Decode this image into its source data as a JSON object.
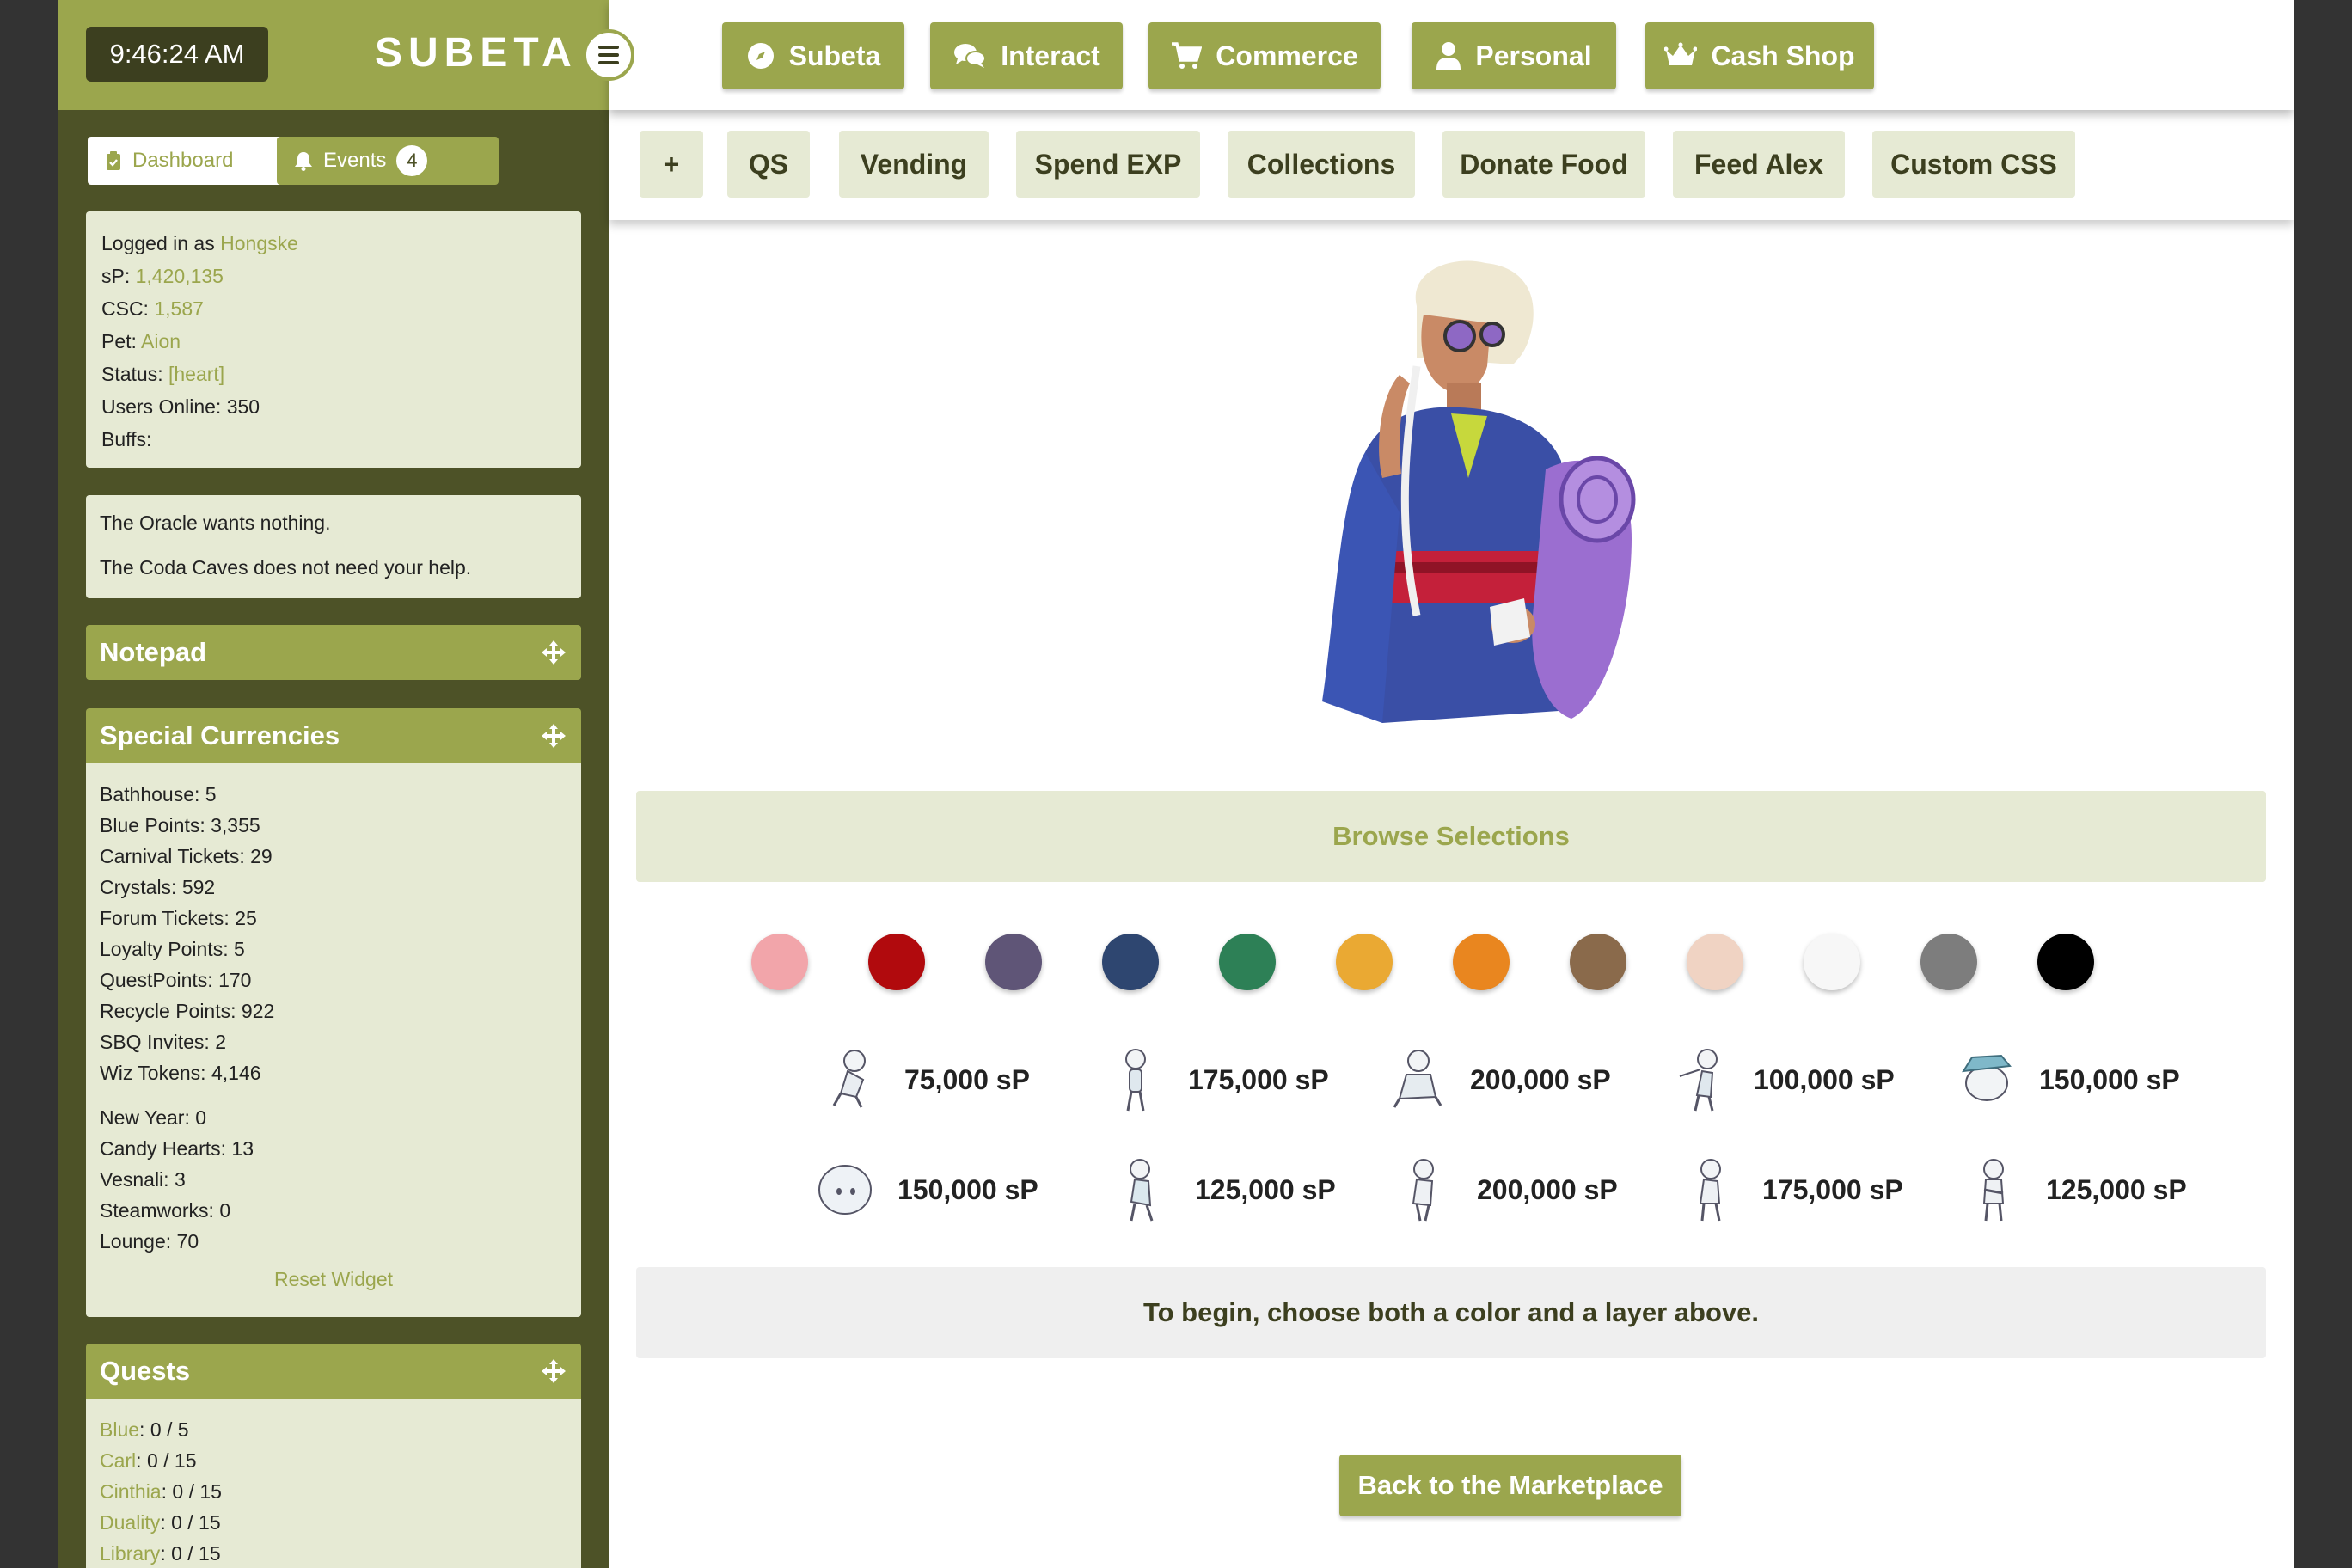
{
  "header": {
    "clock": "9:46:24 AM",
    "site_name": "SUBETA"
  },
  "sidebar": {
    "tabs": {
      "dashboard": "Dashboard",
      "events": "Events",
      "events_count": "4"
    },
    "user": {
      "logged_in_label": "Logged in as ",
      "username": "Hongske",
      "sp_label": "sP: ",
      "sp_value": "1,420,135",
      "csc_label": "CSC: ",
      "csc_value": "1,587",
      "pet_label": "Pet: ",
      "pet_value": "Aion",
      "status_label": "Status: ",
      "status_value": "[heart]",
      "users_online": "Users Online: 350",
      "buffs": "Buffs:"
    },
    "oracle": {
      "line1": "The Oracle wants nothing.",
      "line2": "The Coda Caves does not need your help."
    },
    "notepad": {
      "title": "Notepad"
    },
    "currencies": {
      "title": "Special Currencies",
      "group1": [
        "Bathhouse: 5",
        "Blue Points: 3,355",
        "Carnival Tickets: 29",
        "Crystals: 592",
        "Forum Tickets: 25",
        "Loyalty Points: 5",
        "QuestPoints: 170",
        "Recycle Points: 922",
        "SBQ Invites: 2",
        "Wiz Tokens: 4,146"
      ],
      "group2": [
        "New Year: 0",
        "Candy Hearts: 13",
        "Vesnali: 3",
        "Steamworks: 0",
        "Lounge: 70"
      ],
      "reset": "Reset Widget"
    },
    "quests": {
      "title": "Quests",
      "items": [
        {
          "name": "Blue",
          "progress": ": 0 / 5"
        },
        {
          "name": "Carl",
          "progress": ": 0 / 15"
        },
        {
          "name": "Cinthia",
          "progress": ": 0 / 15"
        },
        {
          "name": "Duality",
          "progress": ": 0 / 15"
        },
        {
          "name": "Library",
          "progress": ": 0 / 15"
        }
      ]
    }
  },
  "top_nav": [
    {
      "label": "Subeta",
      "icon": "compass-icon"
    },
    {
      "label": "Interact",
      "icon": "chat-bubbles-icon"
    },
    {
      "label": "Commerce",
      "icon": "cart-icon"
    },
    {
      "label": "Personal",
      "icon": "user-icon"
    },
    {
      "label": "Cash Shop",
      "icon": "crown-icon"
    }
  ],
  "sub_nav": [
    "+",
    "QS",
    "Vending",
    "Spend EXP",
    "Collections",
    "Donate Food",
    "Feed Alex",
    "Custom CSS"
  ],
  "main": {
    "browse_label": "Browse Selections",
    "colors": [
      "#f2a5aa",
      "#b10a0d",
      "#5f5577",
      "#2e4670",
      "#2d8056",
      "#eaa933",
      "#e9861f",
      "#8a6a4b",
      "#f0d3c3",
      "#f7f7f7",
      "#7d7d7d",
      "#000000"
    ],
    "layers_row1": [
      {
        "price": "75,000 sP",
        "icon": "pose-sitting-icon"
      },
      {
        "price": "175,000 sP",
        "icon": "pose-standing-icon"
      },
      {
        "price": "200,000 sP",
        "icon": "pose-crouching-icon"
      },
      {
        "price": "100,000 sP",
        "icon": "pose-pointing-icon"
      },
      {
        "price": "150,000 sP",
        "icon": "hat-head-icon"
      }
    ],
    "layers_row2": [
      {
        "price": "150,000 sP",
        "icon": "head-icon"
      },
      {
        "price": "125,000 sP",
        "icon": "pose-bent-icon"
      },
      {
        "price": "200,000 sP",
        "icon": "pose-leaning-icon"
      },
      {
        "price": "175,000 sP",
        "icon": "pose-hunched-icon"
      },
      {
        "price": "125,000 sP",
        "icon": "pose-arms-crossed-icon"
      }
    ],
    "hint": "To begin, choose both a color and a layer above.",
    "back_button": "Back to the Marketplace"
  }
}
